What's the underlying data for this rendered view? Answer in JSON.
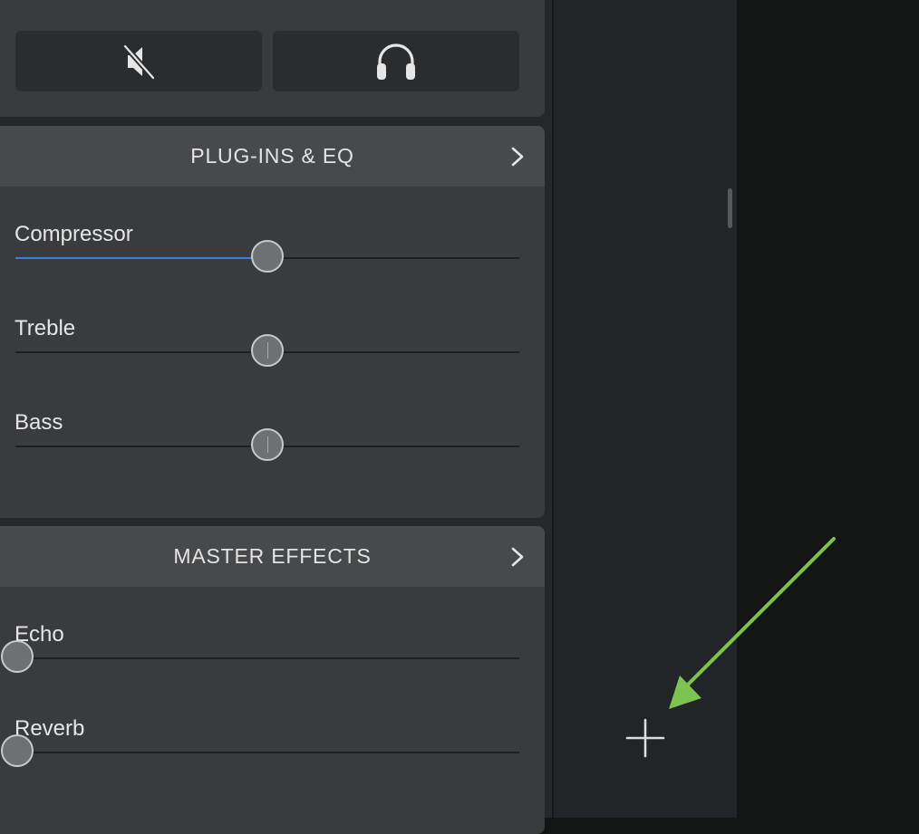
{
  "colors": {
    "panel_background": "#3a3b3d",
    "header_background": "#48494b",
    "slider_fill": "#3d7ee6",
    "annotation_arrow": "#7dc352"
  },
  "top_buttons": [
    {
      "icon": "speaker-muted-icon"
    },
    {
      "icon": "headphones-icon"
    }
  ],
  "plugins_eq": {
    "title": "PLUG-INS & EQ",
    "icon": "chevron-right-icon",
    "sliders": [
      {
        "label": "Compressor",
        "value": 0.5,
        "filled": true
      },
      {
        "label": "Treble",
        "value": 0.5,
        "filled": false
      },
      {
        "label": "Bass",
        "value": 0.5,
        "filled": false
      }
    ]
  },
  "master_effects": {
    "title": "MASTER EFFECTS",
    "icon": "chevron-right-icon",
    "sliders": [
      {
        "label": "Echo",
        "value": 0.0,
        "filled": false
      },
      {
        "label": "Reverb",
        "value": 0.0,
        "filled": false
      }
    ]
  },
  "track_area": {
    "add_icon": "plus-icon"
  }
}
